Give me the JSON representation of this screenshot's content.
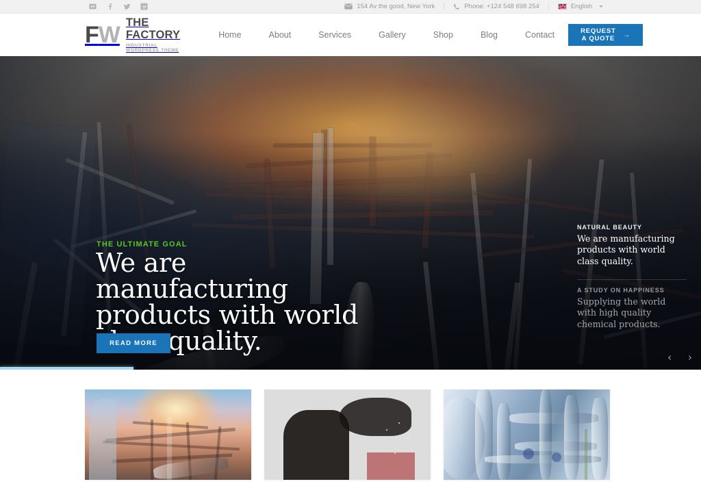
{
  "topbar": {
    "social": [
      {
        "name": "flickr-icon",
        "label": "Flickr"
      },
      {
        "name": "facebook-icon",
        "label": "Facebook"
      },
      {
        "name": "twitter-icon",
        "label": "Twitter"
      },
      {
        "name": "vimeo-icon",
        "label": "Vimeo"
      }
    ],
    "address": "154 Av the good, New York",
    "phone": "Phone: +124 548 698 254",
    "language": "English"
  },
  "header": {
    "logo_mark_f": "F",
    "logo_mark_w": "W",
    "logo_title": "THE FACTORY",
    "logo_sub": "INDUSTRIAL WORDPRESS THEME",
    "nav": [
      {
        "label": "Home"
      },
      {
        "label": "About"
      },
      {
        "label": "Services"
      },
      {
        "label": "Gallery"
      },
      {
        "label": "Shop"
      },
      {
        "label": "Blog"
      },
      {
        "label": "Contact"
      }
    ],
    "quote_label": "REQUEST A QUOTE",
    "quote_arrow": "→"
  },
  "hero": {
    "kicker": "THE ULTIMATE GOAL",
    "title": "We are manufacturing products with world class quality.",
    "read_more_label": "READ MORE",
    "side_items": [
      {
        "label": "NATURAL BEAUTY",
        "text": "We are manufacturing products with world class quality."
      },
      {
        "label": "A STUDY ON HAPPINESS",
        "text": "Supplying the world with high quality chemical products."
      }
    ],
    "prev_arrow": "‹",
    "next_arrow": "›",
    "progress_percent": 19,
    "accent_green": "#5dc421",
    "accent_blue": "#1a74b8",
    "progress_color": "#a8d8ef"
  },
  "cards": [
    {
      "name": "card-refinery-sunset"
    },
    {
      "name": "card-welder-sparks"
    },
    {
      "name": "card-blue-pipes"
    }
  ]
}
